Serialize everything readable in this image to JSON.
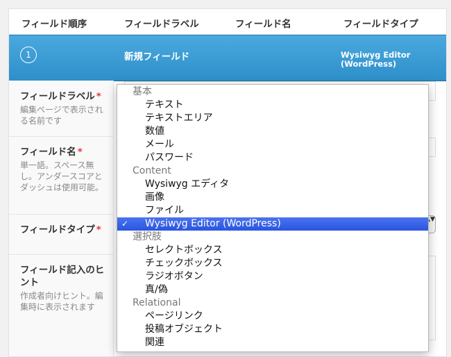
{
  "header": {
    "order": "フィールド順序",
    "label": "フィールドラベル",
    "name": "フィールド名",
    "type": "フィールドタイプ"
  },
  "row": {
    "order_number": "1",
    "label": "新規フィールド",
    "type_line1": "Wysiwyg Editor",
    "type_line2": "(WordPress)"
  },
  "sections": {
    "field_label": {
      "label": "フィールドラベル",
      "required_mark": "*",
      "desc": "編集ページで表示される名前です"
    },
    "field_name": {
      "label": "フィールド名",
      "required_mark": "*",
      "desc": "単一語。スペース無し。アンダースコアとダッシュは使用可能。"
    },
    "field_type": {
      "label": "フィールドタイプ",
      "required_mark": "*"
    },
    "field_hint": {
      "label": "フィールド記入のヒント",
      "desc": "作成者向けヒント。編集時に表示されます"
    }
  },
  "select_arrows": "▲▼",
  "dropdown": {
    "check_mark": "✓",
    "items": [
      {
        "kind": "group",
        "text": "基本"
      },
      {
        "kind": "option",
        "text": "テキスト"
      },
      {
        "kind": "option",
        "text": "テキストエリア"
      },
      {
        "kind": "option",
        "text": "数値"
      },
      {
        "kind": "option",
        "text": "メール"
      },
      {
        "kind": "option",
        "text": "パスワード"
      },
      {
        "kind": "group",
        "text": "Content"
      },
      {
        "kind": "option",
        "text": "Wysiwyg エディタ"
      },
      {
        "kind": "option",
        "text": "画像"
      },
      {
        "kind": "option",
        "text": "ファイル"
      },
      {
        "kind": "option",
        "text": "Wysiwyg Editor (WordPress)",
        "selected": true
      },
      {
        "kind": "group",
        "text": "選択肢"
      },
      {
        "kind": "option",
        "text": "セレクトボックス"
      },
      {
        "kind": "option",
        "text": "チェックボックス"
      },
      {
        "kind": "option",
        "text": "ラジオボタン"
      },
      {
        "kind": "option",
        "text": "真/偽"
      },
      {
        "kind": "group",
        "text": "Relational"
      },
      {
        "kind": "option",
        "text": "ページリンク"
      },
      {
        "kind": "option",
        "text": "投稿オブジェクト"
      },
      {
        "kind": "option",
        "text": "関連"
      }
    ]
  },
  "colors": {
    "accent": "#2e8fca",
    "selected": "#3560e8",
    "required": "#dd3d36"
  }
}
